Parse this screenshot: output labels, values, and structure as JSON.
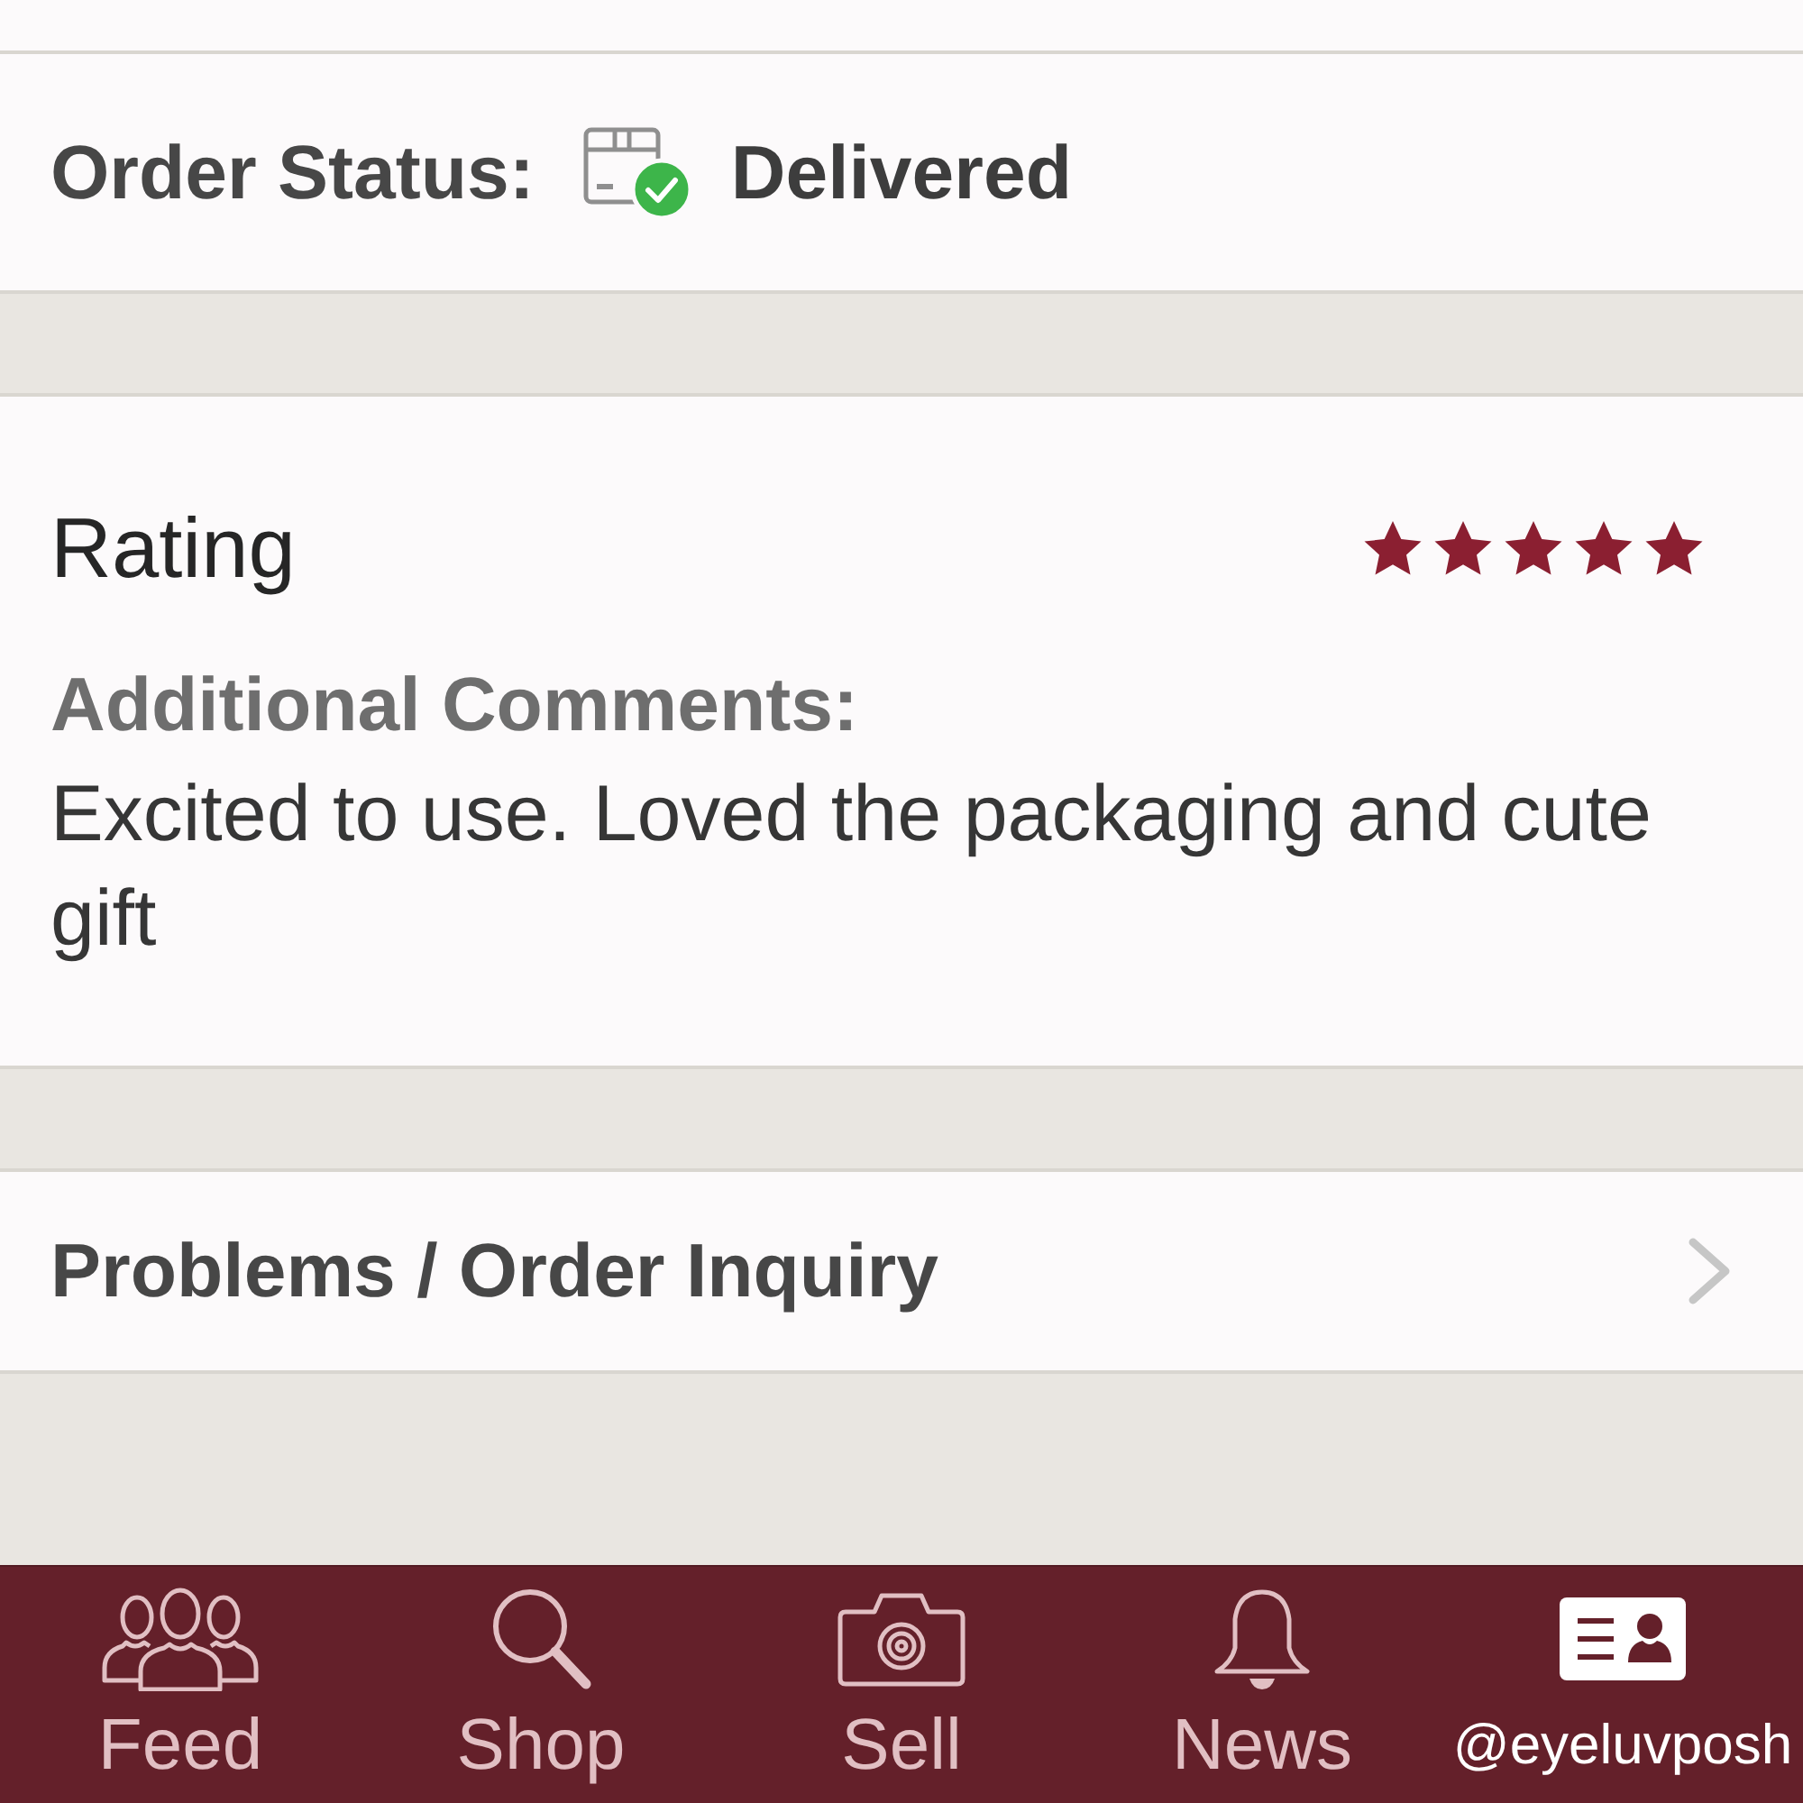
{
  "order_status": {
    "label": "Order Status:",
    "value": "Delivered"
  },
  "rating": {
    "title": "Rating",
    "stars": 5,
    "comments_label": "Additional Comments:",
    "comments": "Excited to use. Loved the packaging and cute gift"
  },
  "menu": [
    {
      "label": "Problems / Order Inquiry"
    }
  ],
  "tab_bar": [
    {
      "label": "Feed",
      "selected": false
    },
    {
      "label": "Shop",
      "selected": false
    },
    {
      "label": "Sell",
      "selected": false
    },
    {
      "label": "News",
      "selected": false
    },
    {
      "label": "@eyeluvposh",
      "selected": true
    }
  ]
}
